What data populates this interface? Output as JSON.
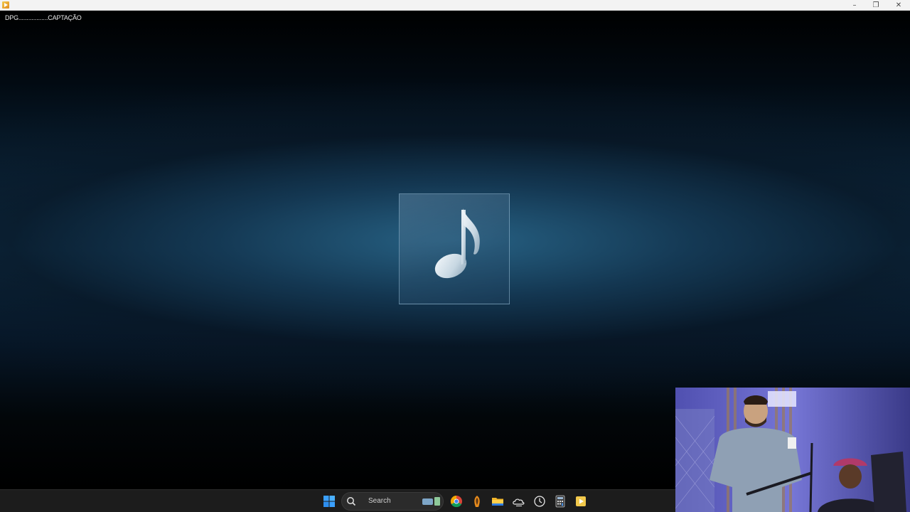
{
  "window": {
    "title": "",
    "controls": {
      "minimize": "–",
      "maximize": "❐",
      "close": "✕"
    }
  },
  "player": {
    "media_title": "DPG..................CAPTAÇÃO",
    "artwork": "music-note-icon"
  },
  "taskbar": {
    "search_label": "Search",
    "apps": [
      "start-icon",
      "chrome-icon",
      "dragon-game-icon",
      "file-explorer-icon",
      "weather-icon",
      "clock-icon",
      "calculator-icon",
      "media-player-icon"
    ]
  },
  "colors": {
    "background_accent": "#0d2c44",
    "taskbar": "#1c1c1c",
    "titlebar": "#f3f3f3"
  }
}
